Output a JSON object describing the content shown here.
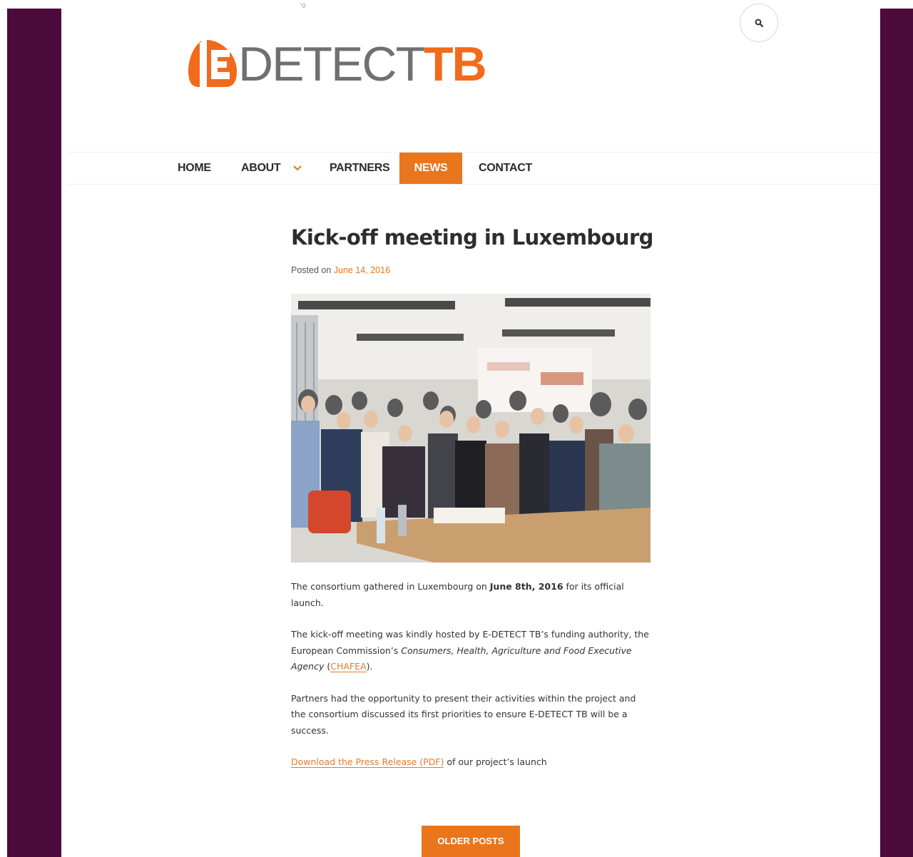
{
  "site": {
    "logo_detect": "DETECT",
    "logo_tb": "TB",
    "accent_color": "#e9761d",
    "frame_color": "#4c0b3c",
    "search_icon": "search-icon",
    "top_mark": "ʻ0"
  },
  "nav": {
    "items": [
      {
        "label": "HOME"
      },
      {
        "label": "ABOUT"
      },
      {
        "label": "PARTNERS"
      },
      {
        "label": "NEWS"
      },
      {
        "label": "CONTACT"
      }
    ],
    "active": "NEWS",
    "about_dropdown_icon": "chevron-down-icon"
  },
  "post": {
    "title": "Kick-off meeting in Luxembourg",
    "posted_on_prefix": "Posted on",
    "date": "June 14, 2016",
    "p1_a": "The consortium gathered in Luxembourg on ",
    "p1_bold": "June 8th, 2016",
    "p1_b": " for its official launch.",
    "p2_a": "The kick-off meeting was kindly hosted by E-DETECT TB’s funding authority, the European Commission’s ",
    "p2_italic": "Consumers, Health, Agriculture and Food Executive Agency",
    "p2_b": " (",
    "p2_link": "CHAFEA",
    "p2_c": ").",
    "p3": "Partners had the opportunity to present their activities within the project and the consortium discussed its first priorities to ensure E-DETECT TB will be a success.",
    "p4_link": "Download the Press Release (PDF)",
    "p4_rest": " of our project’s launch"
  },
  "pagination": {
    "older_label": "OLDER POSTS"
  }
}
